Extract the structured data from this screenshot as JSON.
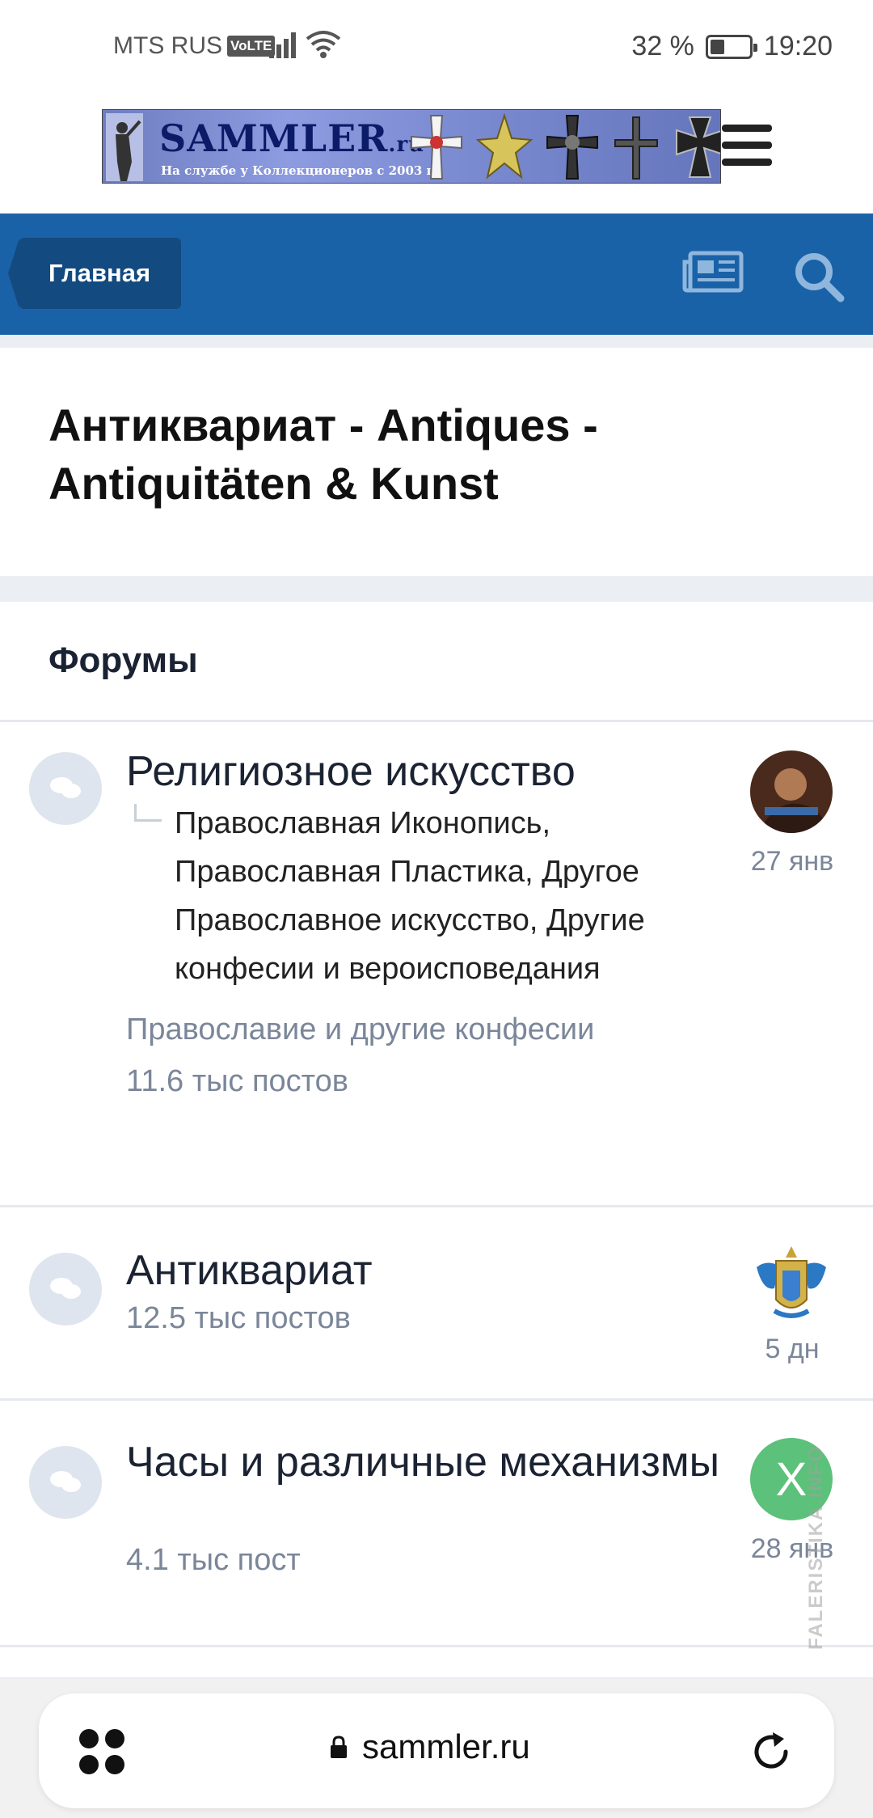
{
  "status_bar": {
    "carrier": "MTS RUS",
    "volte": "VoLTE",
    "battery": "32 %",
    "time": "19:20"
  },
  "header": {
    "logo_name": "SAMMLER",
    "logo_tld": ".ru",
    "logo_tagline": "На службе у Коллекционеров с 2003 г."
  },
  "nav": {
    "home_label": "Главная"
  },
  "page": {
    "title": "Антиквариат - Antiques - Antiquitäten & Kunst"
  },
  "forums": {
    "heading": "Форумы",
    "items": [
      {
        "title": "Религиозное искусство",
        "subforums": "Православная Иконопись, Православная Пластика, Другое Православное искусство, Другие конфесии и вероисповедания",
        "description": "Православие и другие конфесии",
        "posts": "11.6 тыс постов",
        "last_time": "27 янв"
      },
      {
        "title": "Антиквариат",
        "posts": "12.5 тыс постов",
        "last_time": "5 дн"
      },
      {
        "title": "Часы и различные механизмы",
        "posts": "4.1 тыс пост",
        "last_time": "28 янв",
        "avatar_letter": "X",
        "avatar_color": "#5cc17a"
      }
    ]
  },
  "browser": {
    "url": "sammler.ru"
  },
  "watermark": "FALERISTIKA.INFO",
  "colors": {
    "nav_blue": "#1a62a8",
    "crumb_blue": "#134a80",
    "muted_text": "#7b8699"
  }
}
